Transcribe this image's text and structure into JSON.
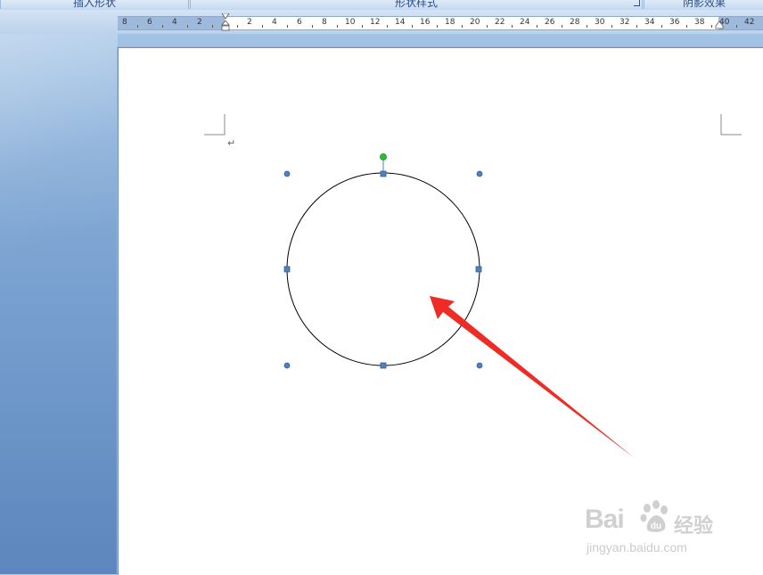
{
  "ribbon": {
    "groups": [
      {
        "label": "插入形状"
      },
      {
        "label": "形状样式"
      },
      {
        "label": "阴影效果"
      }
    ]
  },
  "ruler": {
    "numbers": [
      "8",
      "6",
      "4",
      "2",
      "2",
      "4",
      "6",
      "8",
      "10",
      "12",
      "14",
      "16",
      "18",
      "20",
      "22",
      "24",
      "26",
      "28",
      "30",
      "32",
      "34",
      "36",
      "38",
      "40",
      "42"
    ]
  },
  "document": {
    "paragraph_mark": "↵"
  },
  "shape": {
    "type": "circle",
    "stroke_color": "#000000",
    "handle_color": "#4f81bd",
    "rotate_handle_color": "#22c32e"
  },
  "annotation": {
    "arrow_color": "#ee2b25"
  },
  "watermark": {
    "brand_latin": "Bai",
    "brand_cn": "经验",
    "url": "jingyan.baidu.com"
  }
}
